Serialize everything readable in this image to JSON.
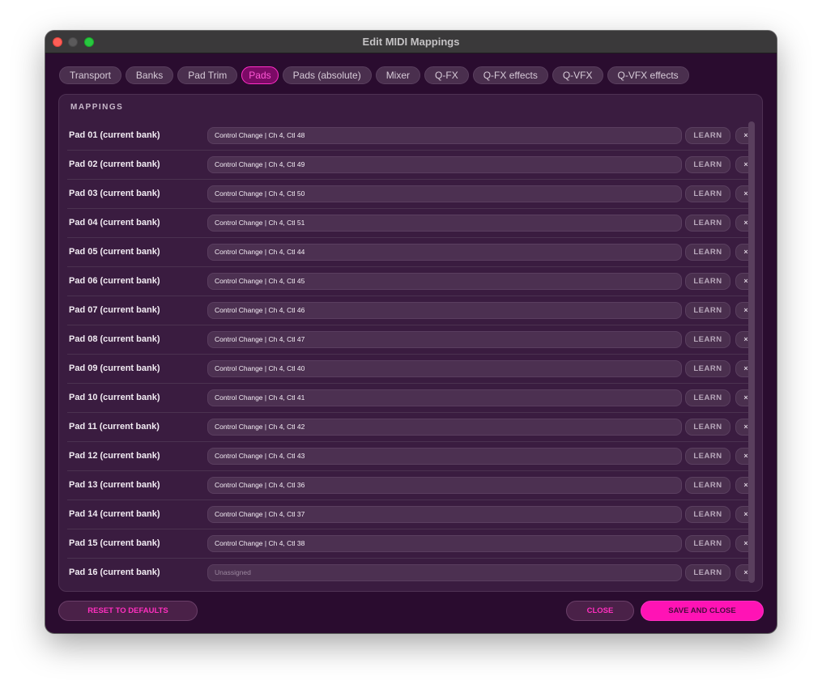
{
  "window": {
    "title": "Edit MIDI Mappings"
  },
  "tabs": [
    {
      "label": "Transport",
      "active": false
    },
    {
      "label": "Banks",
      "active": false
    },
    {
      "label": "Pad Trim",
      "active": false
    },
    {
      "label": "Pads",
      "active": true
    },
    {
      "label": "Pads (absolute)",
      "active": false
    },
    {
      "label": "Mixer",
      "active": false
    },
    {
      "label": "Q-FX",
      "active": false
    },
    {
      "label": "Q-FX effects",
      "active": false
    },
    {
      "label": "Q-VFX",
      "active": false
    },
    {
      "label": "Q-VFX effects",
      "active": false
    }
  ],
  "mappings": {
    "title": "MAPPINGS",
    "learn_label": "LEARN",
    "clear_label": "×",
    "rows": [
      {
        "label": "Pad 01 (current bank)",
        "value": "Control Change | Ch 4, Ctl 48"
      },
      {
        "label": "Pad 02 (current bank)",
        "value": "Control Change | Ch 4, Ctl 49"
      },
      {
        "label": "Pad 03 (current bank)",
        "value": "Control Change | Ch 4, Ctl 50"
      },
      {
        "label": "Pad 04 (current bank)",
        "value": "Control Change | Ch 4, Ctl 51"
      },
      {
        "label": "Pad 05 (current bank)",
        "value": "Control Change | Ch 4, Ctl 44"
      },
      {
        "label": "Pad 06 (current bank)",
        "value": "Control Change | Ch 4, Ctl 45"
      },
      {
        "label": "Pad 07 (current bank)",
        "value": "Control Change | Ch 4, Ctl 46"
      },
      {
        "label": "Pad 08 (current bank)",
        "value": "Control Change | Ch 4, Ctl 47"
      },
      {
        "label": "Pad 09 (current bank)",
        "value": "Control Change | Ch 4, Ctl 40"
      },
      {
        "label": "Pad 10 (current bank)",
        "value": "Control Change | Ch 4, Ctl 41"
      },
      {
        "label": "Pad 11 (current bank)",
        "value": "Control Change | Ch 4, Ctl 42"
      },
      {
        "label": "Pad 12 (current bank)",
        "value": "Control Change | Ch 4, Ctl 43"
      },
      {
        "label": "Pad 13 (current bank)",
        "value": "Control Change | Ch 4, Ctl 36"
      },
      {
        "label": "Pad 14 (current bank)",
        "value": "Control Change | Ch 4, Ctl 37"
      },
      {
        "label": "Pad 15 (current bank)",
        "value": "Control Change | Ch 4, Ctl 38"
      },
      {
        "label": "Pad 16 (current bank)",
        "value": "",
        "placeholder": "Unassigned"
      }
    ]
  },
  "footer": {
    "reset_label": "RESET TO DEFAULTS",
    "close_label": "CLOSE",
    "save_label": "SAVE AND CLOSE"
  },
  "colors": {
    "window_bg": "#2a0c2f",
    "panel_bg": "#3a1c40",
    "accent": "#ff13b5",
    "accent_text": "#ff2fbf"
  }
}
